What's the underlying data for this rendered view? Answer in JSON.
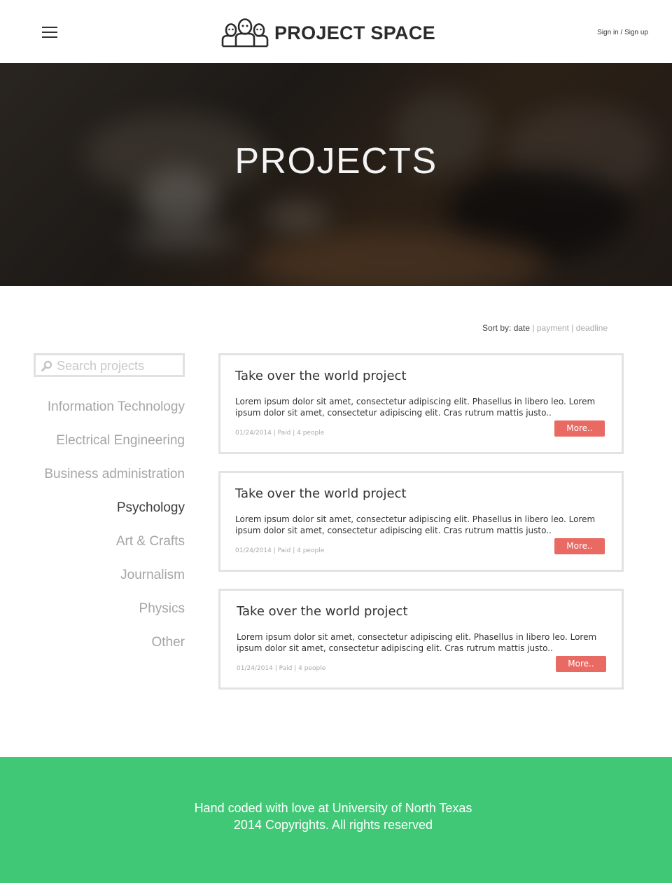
{
  "header": {
    "logo_text": "PROJECT SPACE",
    "auth_sign_in": "Sign in",
    "auth_separator": " / ",
    "auth_sign_up": "Sign up"
  },
  "hero": {
    "title": "PROJECTS"
  },
  "sort": {
    "label": "Sort  by:",
    "options": [
      "date",
      "payment",
      "deadline"
    ],
    "active": "date",
    "separator": " | "
  },
  "search": {
    "placeholder": "Search projects",
    "value": ""
  },
  "categories": {
    "items": [
      {
        "label": "Information Technology"
      },
      {
        "label": "Electrical Engineering"
      },
      {
        "label": "Business administration"
      },
      {
        "label": "Psychology",
        "active": true
      },
      {
        "label": "Art & Crafts"
      },
      {
        "label": "Journalism"
      },
      {
        "label": "Physics"
      },
      {
        "label": "Other"
      }
    ]
  },
  "projects": [
    {
      "title": "Take over the world project",
      "description": "Lorem ipsum dolor sit amet, consectetur adipiscing elit. Phasellus in libero leo. Lorem ipsum dolor sit amet, consectetur adipiscing elit. Cras rutrum mattis justo..",
      "meta": "01/24/2014 | Paid | 4 people",
      "button": "More.."
    },
    {
      "title": "Take over the world project",
      "description": "Lorem ipsum dolor sit amet, consectetur adipiscing elit. Phasellus in libero leo. Lorem ipsum dolor sit amet, consectetur adipiscing elit. Cras rutrum mattis justo..",
      "meta": "01/24/2014 | Paid | 4 people",
      "button": "More.."
    },
    {
      "title": "Take over the world project",
      "description": "Lorem ipsum dolor sit amet, consectetur adipiscing elit. Phasellus in libero leo. Lorem ipsum dolor sit amet, consectetur adipiscing elit. Cras rutrum mattis justo..",
      "meta": "01/24/2014 | Paid | 4 people",
      "button": "More.."
    }
  ],
  "footer": {
    "line1": "Hand coded with love at University of North Texas",
    "line2": "2014 Copyrights. All rights reserved"
  },
  "colors": {
    "accent_button": "#e96a63",
    "footer_bg": "#41c877",
    "category_active": "#3a3a3a",
    "category_inactive": "#a5a5a5"
  },
  "icons": {
    "menu": "hamburger-menu-icon",
    "logo": "people-group-icon",
    "search": "search-icon"
  }
}
